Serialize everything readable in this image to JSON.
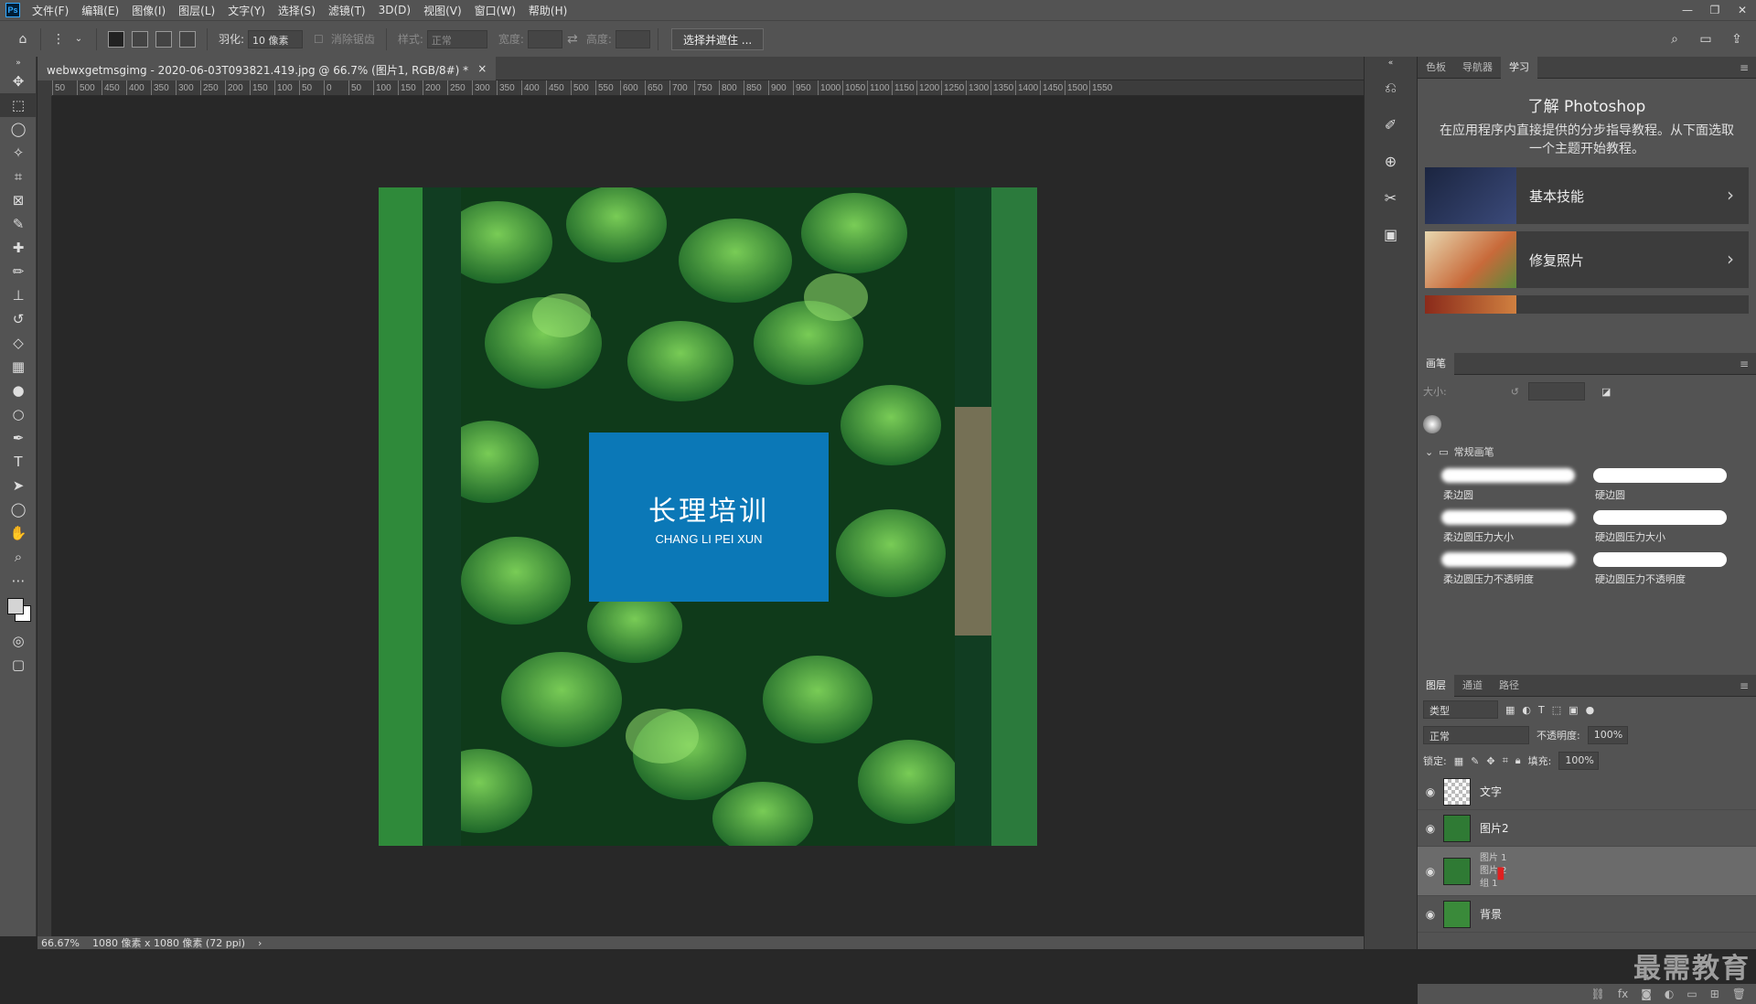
{
  "app": {
    "logo": "Ps"
  },
  "menu": [
    "文件(F)",
    "编辑(E)",
    "图像(I)",
    "图层(L)",
    "文字(Y)",
    "选择(S)",
    "滤镜(T)",
    "3D(D)",
    "视图(V)",
    "窗口(W)",
    "帮助(H)"
  ],
  "options": {
    "feather_label": "羽化:",
    "feather_value": "10 像素",
    "antialias_label": "消除锯齿",
    "style_label": "样式:",
    "style_value": "正常",
    "width_label": "宽度:",
    "height_label": "高度:",
    "select_mask_button": "选择并遮住 ..."
  },
  "document": {
    "tab_title": "webwxgetmsgimg - 2020-06-03T093821.419.jpg @ 66.7% (图片1, RGB/8#) *",
    "close": "×",
    "zoom": "66.67%",
    "size": "1080 像素 x 1080 像素 (72 ppi)",
    "status_arrow": "›"
  },
  "ruler_h": [
    "50",
    "500",
    "450",
    "400",
    "350",
    "300",
    "250",
    "200",
    "150",
    "100",
    "50",
    "0",
    "50",
    "100",
    "150",
    "200",
    "250",
    "300",
    "350",
    "400",
    "450",
    "500",
    "550",
    "600",
    "650",
    "700",
    "750",
    "800",
    "850",
    "900",
    "950",
    "1000",
    "1050",
    "1100",
    "1150",
    "1200",
    "1250",
    "1300",
    "1350",
    "1400",
    "1450",
    "1500",
    "1550"
  ],
  "artwork": {
    "title": "长理培训",
    "subtitle": "CHANG LI PEI XUN",
    "box_color": "#0b78b7"
  },
  "learn_panel": {
    "tabs": [
      "色板",
      "导航器",
      "学习"
    ],
    "active_tab": "学习",
    "title": "了解 Photoshop",
    "description": "在应用程序内直接提供的分步指导教程。从下面选取一个主题开始教程。",
    "cards": [
      "基本技能",
      "修复照片"
    ]
  },
  "brush_panel": {
    "tab": "画笔",
    "size_label": "大小:",
    "folder": "常规画笔",
    "brushes": [
      "柔边圆",
      "硬边圆",
      "柔边圆压力大小",
      "硬边圆压力大小",
      "柔边圆压力不透明度",
      "硬边圆压力不透明度"
    ]
  },
  "layers_panel": {
    "tabs": [
      "图层",
      "通道",
      "路径"
    ],
    "filter": "类型",
    "blend_mode": "正常",
    "opacity_label": "不透明度:",
    "opacity_value": "100%",
    "lock_label": "锁定:",
    "fill_label": "填充:",
    "fill_value": "100%",
    "layers": [
      {
        "name": "文字"
      },
      {
        "name": "图片2"
      },
      {
        "name": "图片 1"
      },
      {
        "name": "背景"
      }
    ],
    "drag_overlay": [
      "图片 2",
      "组 1"
    ]
  },
  "watermark": "最需教育"
}
